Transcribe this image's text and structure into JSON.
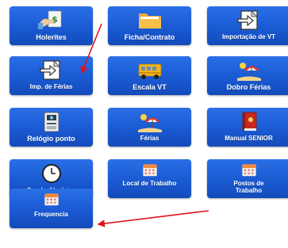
{
  "tiles": {
    "holerites": "Holerites",
    "ficha_contrato": "Ficha/Contrato",
    "importacao_vt": "Importação de VT",
    "imp_ferias": "Imp. de Férias",
    "escala_vt": "Escala VT",
    "dobro_ferias": "Dobro Férias",
    "relogio_ponto": "Relógio ponto",
    "ferias": "Férias",
    "manual_senior": "Manual SENIOR",
    "escalas_horarios": "Escalas/Horários",
    "local_trabalho": "Local de Trabalho",
    "postos_trabalho": "Postos de Trabalho",
    "frequencia": "Frequencia"
  },
  "icons": {
    "holerites": "payslip-money-icon",
    "ficha_contrato": "folder-icon",
    "importacao_vt": "import-arrow-icon",
    "imp_ferias": "import-arrow-icon",
    "escala_vt": "bus-icon",
    "dobro_ferias": "beach-umbrella-icon",
    "relogio_ponto": "time-clock-icon",
    "ferias": "beach-umbrella-icon",
    "manual_senior": "book-icon",
    "escalas_horarios": "clock-icon",
    "local_trabalho": "calendar-icon",
    "postos_trabalho": "calendar-icon",
    "frequencia": "calendar-icon"
  },
  "colors": {
    "tile_top": "#2a6fe6",
    "tile_bottom": "#134bbb",
    "annotation_arrow": "#e0141e"
  }
}
